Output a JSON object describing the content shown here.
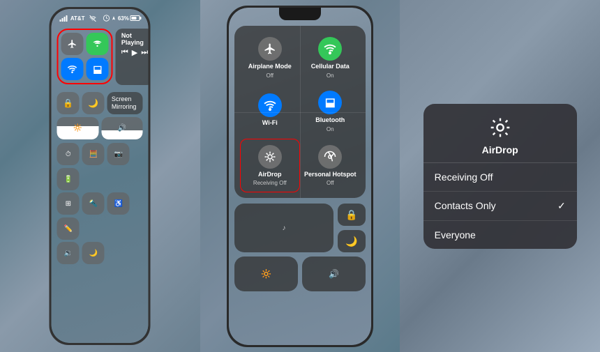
{
  "panels": {
    "panel1": {
      "status": {
        "carrier": "AT&T",
        "battery_percent": "63%",
        "wifi_icon": "wifi"
      },
      "now_playing": {
        "title": "Not Playing",
        "prev": "⏮",
        "play": "▶",
        "next": "⏭"
      },
      "buttons": {
        "airplane": "✈",
        "cellular": "((·))",
        "wifi": "wifi",
        "bluetooth": "bt"
      },
      "bottom_row": [
        {
          "icon": "🔒",
          "name": "rotation-lock"
        },
        {
          "icon": "🌙",
          "name": "do-not-disturb"
        },
        {
          "icon": "📺",
          "name": "screen-mirroring-label",
          "label": "Screen\nMirroring"
        },
        {
          "icon": "🔆",
          "name": "brightness"
        },
        {
          "icon": "🔊",
          "name": "volume"
        }
      ]
    },
    "panel2": {
      "connectivity": [
        {
          "icon": "✈",
          "label": "Airplane Mode",
          "sub": "Off",
          "color": "gray"
        },
        {
          "icon": "((·))",
          "label": "Cellular Data",
          "sub": "On",
          "color": "green"
        },
        {
          "icon": "wifi",
          "label": "Wi-Fi",
          "sub": "",
          "color": "blue"
        },
        {
          "icon": "bt",
          "label": "Bluetooth",
          "sub": "On",
          "color": "blue"
        },
        {
          "icon": "airdrop",
          "label": "AirDrop",
          "sub": "Receiving Off",
          "color": "gray",
          "red_border": true
        },
        {
          "icon": "hotspot",
          "label": "Personal Hotspot",
          "sub": "Off",
          "color": "gray"
        }
      ]
    },
    "panel3": {
      "popup": {
        "title": "AirDrop",
        "icon": "airdrop",
        "options": [
          {
            "label": "Receiving Off",
            "checked": false
          },
          {
            "label": "Contacts Only",
            "checked": true
          },
          {
            "label": "Everyone",
            "checked": false
          }
        ]
      }
    }
  }
}
